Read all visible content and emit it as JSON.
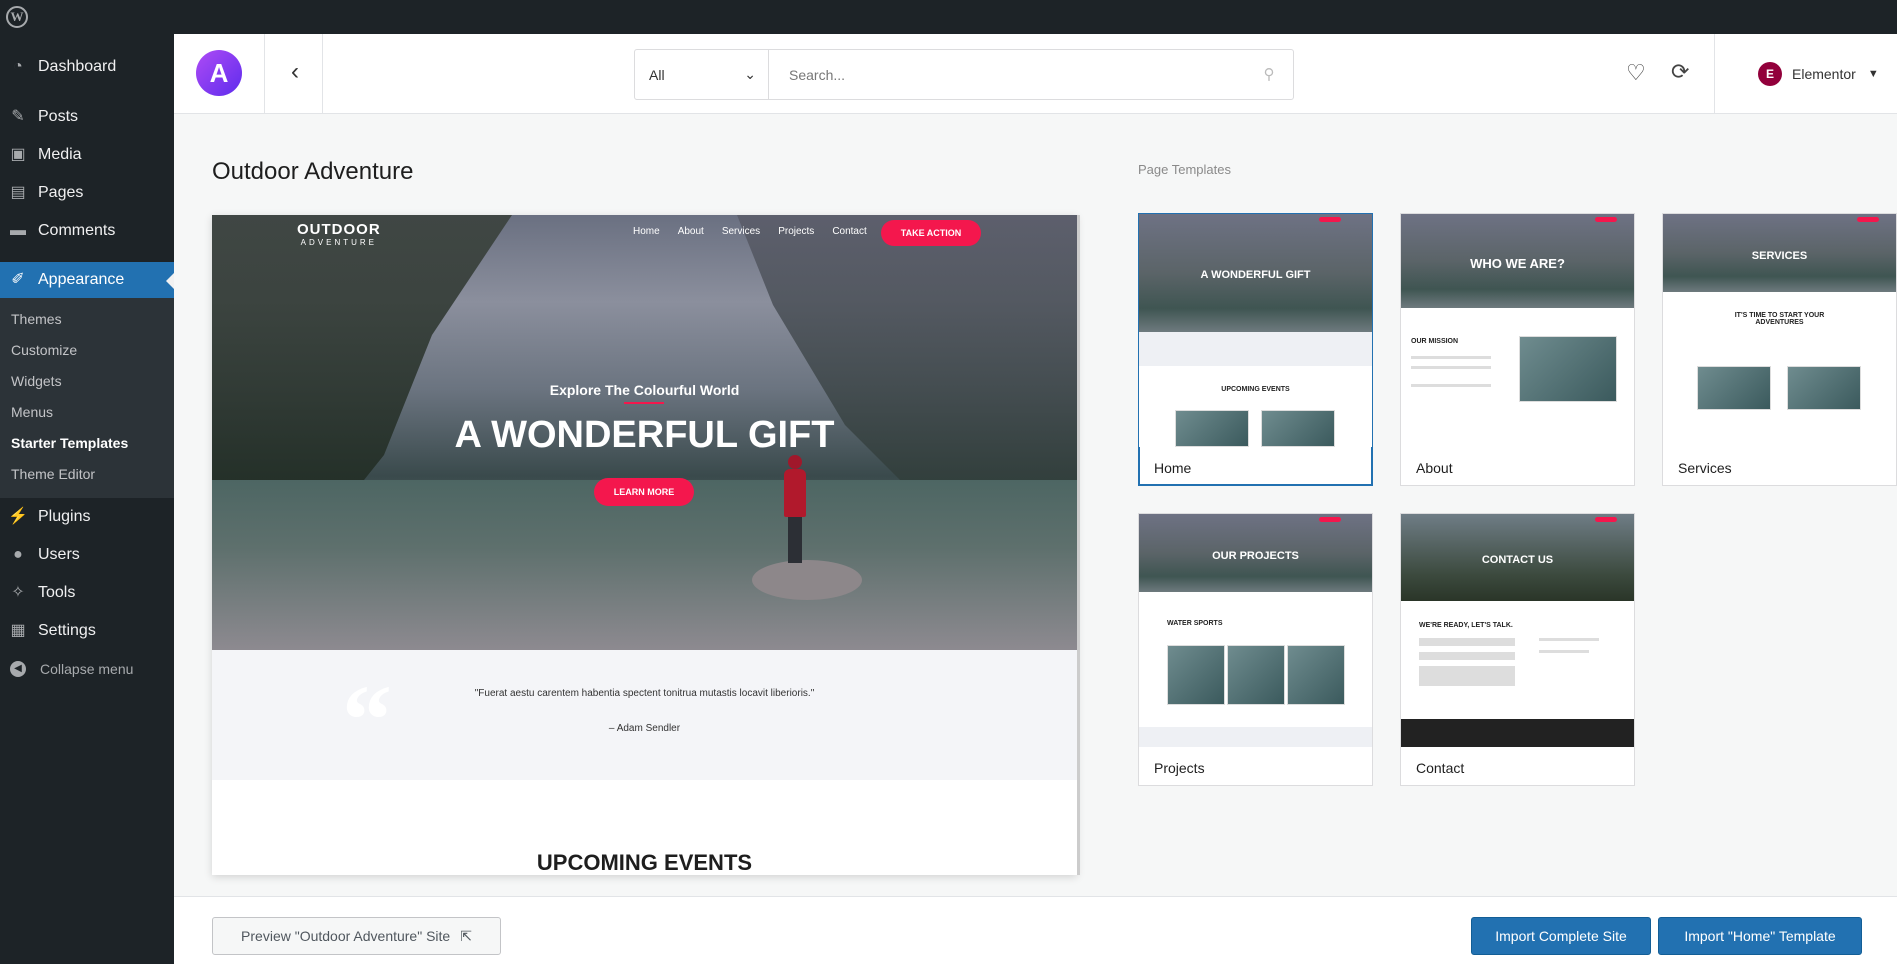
{
  "adminbar": {
    "logo_icon": "wordpress-logo-icon",
    "logo_glyph": "W"
  },
  "sidebar": {
    "items_top": [
      {
        "label": "Dashboard",
        "icon": "dashboard-icon"
      },
      {
        "label": "Posts",
        "icon": "pin-icon"
      },
      {
        "label": "Media",
        "icon": "media-icon"
      },
      {
        "label": "Pages",
        "icon": "pages-icon"
      },
      {
        "label": "Comments",
        "icon": "comments-icon"
      }
    ],
    "appearance": {
      "label": "Appearance",
      "icon": "brush-icon"
    },
    "appearance_sub": [
      "Themes",
      "Customize",
      "Widgets",
      "Menus",
      "Starter Templates",
      "Theme Editor"
    ],
    "items_bottom": [
      {
        "label": "Plugins",
        "icon": "plug-icon"
      },
      {
        "label": "Users",
        "icon": "user-icon"
      },
      {
        "label": "Tools",
        "icon": "wrench-icon"
      },
      {
        "label": "Settings",
        "icon": "settings-icon"
      }
    ],
    "collapse_label": "Collapse menu"
  },
  "header": {
    "logo_glyph": "A",
    "search_category": "All",
    "search_placeholder": "Search...",
    "builder_label": "Elementor",
    "builder_glyph": "E"
  },
  "site": {
    "title": "Outdoor Adventure",
    "preview": {
      "logo_line1": "OUTDOOR",
      "logo_line2": "ADVENTURE",
      "nav": [
        "Home",
        "About",
        "Services",
        "Projects",
        "Contact"
      ],
      "cta": "TAKE ACTION",
      "kicker": "Explore The Colourful World",
      "headline": "A WONDERFUL GIFT",
      "hero_button": "LEARN MORE",
      "quote": "\"Fuerat aestu carentem habentia spectent tonitrua mutastis locavit liberioris.\"",
      "quote_author": "– Adam Sendler",
      "events_heading": "UPCOMING EVENTS"
    }
  },
  "templates": {
    "section_label": "Page Templates",
    "cards": [
      {
        "name": "Home",
        "thumb_heading": "A WONDERFUL GIFT",
        "thumb_sub": "UPCOMING EVENTS"
      },
      {
        "name": "About",
        "thumb_heading": "WHO WE ARE?",
        "thumb_sub": "OUR MISSION"
      },
      {
        "name": "Services",
        "thumb_heading": "SERVICES",
        "thumb_sub": "IT'S TIME TO START YOUR ADVENTURES"
      },
      {
        "name": "Projects",
        "thumb_heading": "OUR PROJECTS",
        "thumb_sub": "WATER SPORTS"
      },
      {
        "name": "Contact",
        "thumb_heading": "CONTACT US",
        "thumb_sub": "WE'RE READY, LET'S TALK."
      }
    ]
  },
  "footer": {
    "preview_button": "Preview \"Outdoor Adventure\" Site",
    "import_site_button": "Import Complete Site",
    "import_template_button": "Import \"Home\" Template"
  },
  "colors": {
    "wp_blue": "#2271b1",
    "admin_dark": "#1d2327",
    "accent_pink": "#f4174d"
  }
}
